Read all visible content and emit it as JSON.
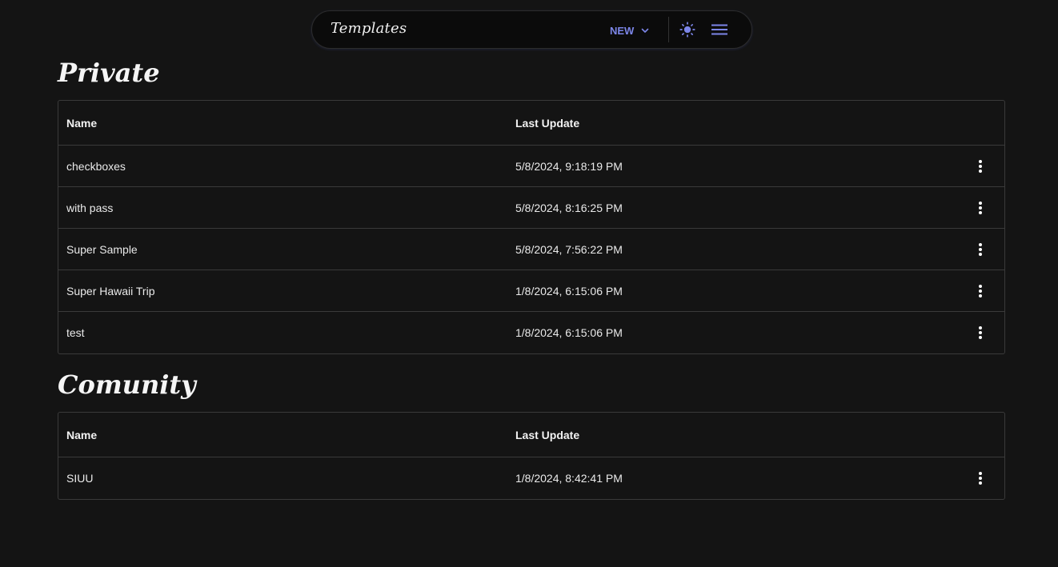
{
  "topbar": {
    "title": "Templates",
    "new_label": "NEW",
    "accent_color": "#7c86e8",
    "icons": [
      "chevron-down-icon",
      "sun-icon",
      "hamburger-menu-icon"
    ]
  },
  "sections": [
    {
      "title": "Private",
      "columns": [
        "Name",
        "Last Update"
      ],
      "rows": [
        {
          "name": "checkboxes",
          "updated": "5/8/2024, 9:18:19 PM"
        },
        {
          "name": "with pass",
          "updated": "5/8/2024, 8:16:25 PM"
        },
        {
          "name": "Super Sample",
          "updated": "5/8/2024, 7:56:22 PM"
        },
        {
          "name": "Super Hawaii Trip",
          "updated": "1/8/2024, 6:15:06 PM"
        },
        {
          "name": "test",
          "updated": "1/8/2024, 6:15:06 PM"
        }
      ]
    },
    {
      "title": "Comunity",
      "columns": [
        "Name",
        "Last Update"
      ],
      "rows": [
        {
          "name": "SIUU",
          "updated": "1/8/2024, 8:42:41 PM"
        }
      ]
    }
  ]
}
